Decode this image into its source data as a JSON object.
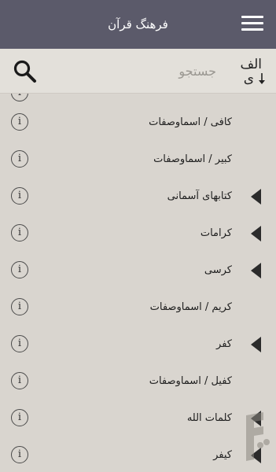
{
  "header": {
    "title": "فرهنگ قرآن",
    "menu_icon": "menu-icon"
  },
  "search": {
    "placeholder": "جستجو",
    "sort_label_top": "الف",
    "sort_label_bottom": "ی",
    "sort_icon": "sort-alpha-down-icon",
    "search_icon": "search-icon"
  },
  "list": {
    "info_glyph": "i",
    "items": [
      {
        "label": "کافی / اسماوصفات",
        "expandable": false
      },
      {
        "label": "کبیر / اسماوصفات",
        "expandable": false
      },
      {
        "label": "کتابهای آسمانی",
        "expandable": true
      },
      {
        "label": "کرامات",
        "expandable": true
      },
      {
        "label": "کرسی",
        "expandable": true
      },
      {
        "label": "کریم / اسماوصفات",
        "expandable": false
      },
      {
        "label": "کفر",
        "expandable": true
      },
      {
        "label": "کفیل / اسماوصفات",
        "expandable": false
      },
      {
        "label": "کلمات الله",
        "expandable": true
      },
      {
        "label": "کیفر",
        "expandable": true
      }
    ]
  },
  "colors": {
    "appbar": "#5b5a6a",
    "background": "#d9d5cf",
    "searchbar": "#e3e0da",
    "text": "#1e1e1e"
  }
}
